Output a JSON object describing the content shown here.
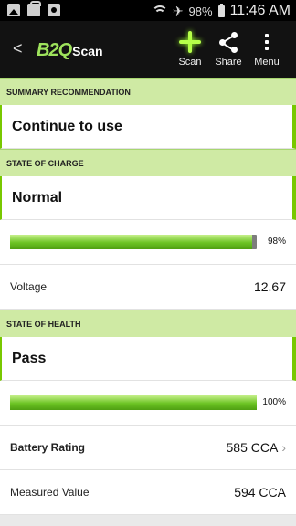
{
  "status_bar": {
    "battery": "98%",
    "time": "11:46 AM"
  },
  "app_bar": {
    "logo_mark": "B2Q",
    "logo_text": "Scan",
    "actions": [
      {
        "label": "Scan",
        "icon": "plus-icon"
      },
      {
        "label": "Share",
        "icon": "share-icon"
      },
      {
        "label": "Menu",
        "icon": "overflow-menu-icon"
      }
    ]
  },
  "summary": {
    "header": "SUMMARY RECOMMENDATION",
    "value": "Continue to use"
  },
  "charge": {
    "header": "STATE OF CHARGE",
    "status": "Normal",
    "bar_percent": 98,
    "bar_label": "98%",
    "voltage_label": "Voltage",
    "voltage_value": "12.67"
  },
  "health": {
    "header": "STATE OF HEALTH",
    "status": "Pass",
    "bar_percent": 100,
    "bar_label": "100%",
    "rating_label": "Battery Rating",
    "rating_value": "585 CCA",
    "measured_label": "Measured Value",
    "measured_value": "594 CCA"
  },
  "colors": {
    "accent": "#78c800",
    "header_bg": "#cfeaa4",
    "scan_icon": "#b7ff4a"
  }
}
